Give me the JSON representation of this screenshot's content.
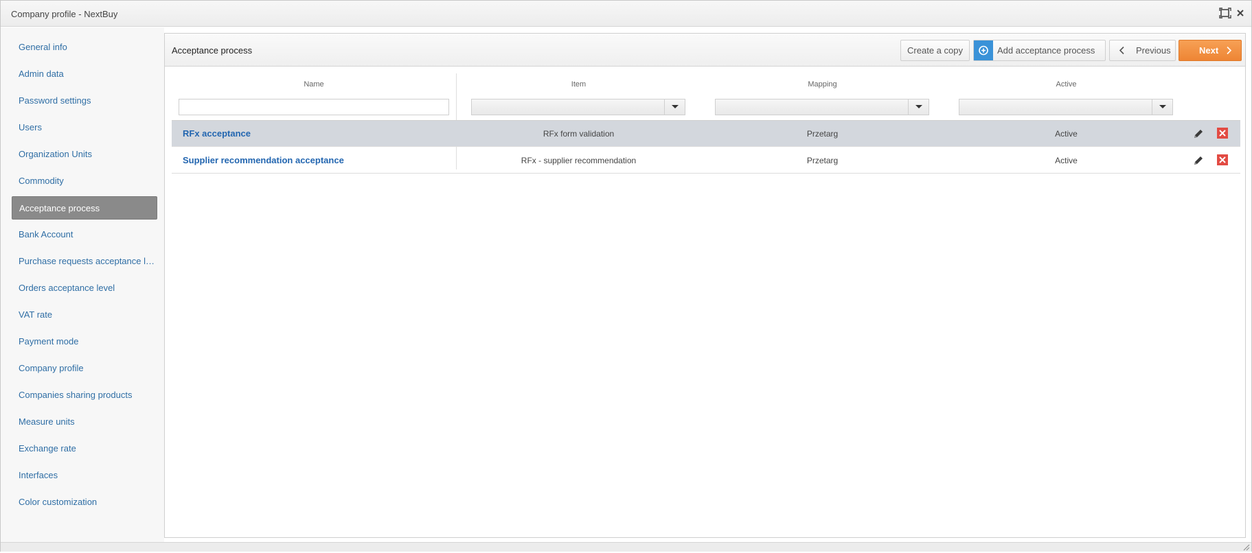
{
  "window": {
    "title": "Company profile - NextBuy"
  },
  "sidebar": {
    "items": [
      {
        "label": "General info",
        "active": false
      },
      {
        "label": "Admin data",
        "active": false
      },
      {
        "label": "Password settings",
        "active": false
      },
      {
        "label": "Users",
        "active": false
      },
      {
        "label": "Organization Units",
        "active": false
      },
      {
        "label": "Commodity",
        "active": false
      },
      {
        "label": "Acceptance process",
        "active": true
      },
      {
        "label": "Bank Account",
        "active": false
      },
      {
        "label": "Purchase requests acceptance le...",
        "active": false
      },
      {
        "label": "Orders acceptance level",
        "active": false
      },
      {
        "label": "VAT rate",
        "active": false
      },
      {
        "label": "Payment mode",
        "active": false
      },
      {
        "label": "Company profile",
        "active": false
      },
      {
        "label": "Companies sharing products",
        "active": false
      },
      {
        "label": "Measure units",
        "active": false
      },
      {
        "label": "Exchange rate",
        "active": false
      },
      {
        "label": "Interfaces",
        "active": false
      },
      {
        "label": "Color customization",
        "active": false
      }
    ]
  },
  "panel": {
    "title": "Acceptance process",
    "buttons": {
      "create_copy": "Create a copy",
      "add": "Add acceptance process",
      "previous": "Previous",
      "next": "Next"
    }
  },
  "table": {
    "columns": [
      "Name",
      "Item",
      "Mapping",
      "Active"
    ],
    "filters": {
      "name": "",
      "item": "",
      "mapping": "",
      "active": ""
    },
    "rows": [
      {
        "name": "RFx acceptance",
        "item": "RFx form validation",
        "mapping": "Przetarg",
        "active": "Active",
        "selected": true
      },
      {
        "name": "Supplier recommendation acceptance",
        "item": "RFx - supplier recommendation",
        "mapping": "Przetarg",
        "active": "Active",
        "selected": false
      }
    ]
  },
  "colors": {
    "accent_orange": "#ee8534",
    "accent_blue": "#3a92d8",
    "link_blue": "#2366b0",
    "delete_red": "#e24b43",
    "active_item_bg": "#8a8a8a",
    "selected_row_bg": "#d3d7dd"
  },
  "icons": {
    "maximize": "maximize-icon",
    "close": "close-icon",
    "add": "plus-circle-icon",
    "previous": "chevron-left-icon",
    "next": "chevron-right-icon",
    "dropdown": "caret-down-icon",
    "edit": "pencil-icon",
    "delete": "delete-icon",
    "resize": "resize-grip-icon"
  }
}
